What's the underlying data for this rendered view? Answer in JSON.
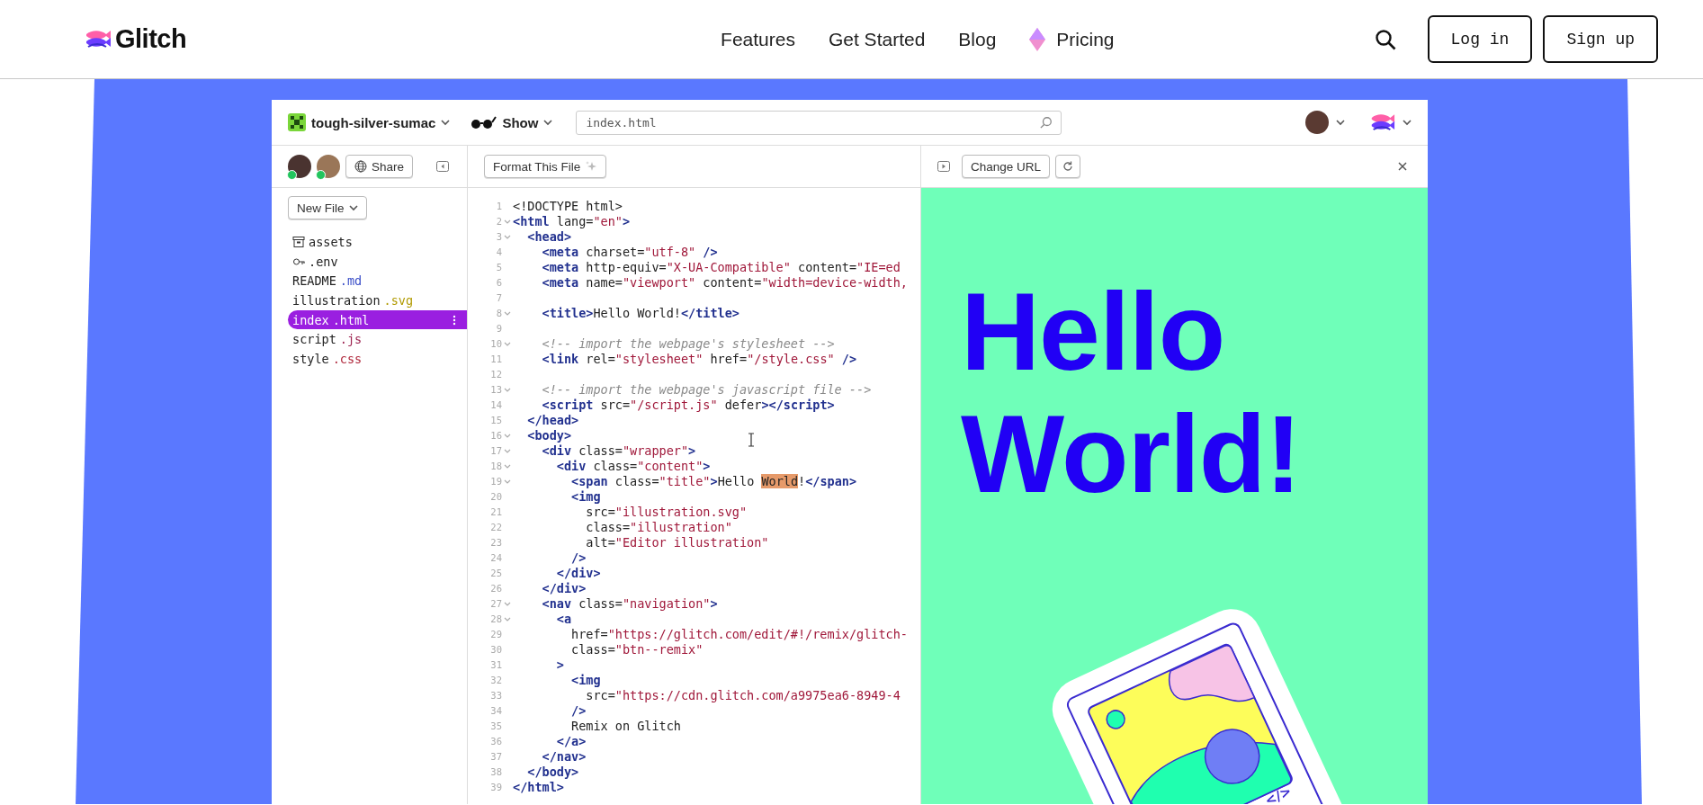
{
  "site_nav": {
    "logo": "Glitch",
    "links": [
      {
        "label": "Features"
      },
      {
        "label": "Get Started"
      },
      {
        "label": "Blog"
      },
      {
        "label": "Pricing",
        "kind": "gem"
      }
    ],
    "buttons": [
      {
        "label": "Log in"
      },
      {
        "label": "Sign up"
      }
    ]
  },
  "editor": {
    "project_name": "tough-silver-sumac",
    "show_label": "Show",
    "search": {
      "value": "index.html"
    },
    "sidebar": {
      "share_label": "Share",
      "new_file_label": "New File",
      "files": [
        {
          "kind": "assets",
          "name": "assets",
          "selected": false
        },
        {
          "kind": "env",
          "name": ".env",
          "selected": false
        },
        {
          "kind": "md",
          "name": "README",
          "extension": ".md",
          "selected": false
        },
        {
          "kind": "svg",
          "name": "illustration",
          "extension": ".svg",
          "selected": false
        },
        {
          "kind": "html",
          "name": "index",
          "extension": ".html",
          "selected": true
        },
        {
          "kind": "js",
          "name": "script",
          "extension": ".js",
          "selected": false
        },
        {
          "kind": "css",
          "name": "style",
          "extension": ".css",
          "selected": false
        }
      ]
    },
    "code_toolbar": {
      "format_label": "Format This File"
    },
    "code": {
      "lines": [
        {
          "number": "1",
          "foldable": false,
          "tokens": [
            {
              "kind": "text",
              "text": "<!DOCTYPE html>"
            }
          ]
        },
        {
          "number": "2",
          "foldable": true,
          "tokens": [
            {
              "kind": "tag",
              "text": "<html"
            },
            {
              "kind": "text",
              "text": " lang="
            },
            {
              "kind": "string",
              "text": "\"en\""
            },
            {
              "kind": "tag",
              "text": ">"
            }
          ]
        },
        {
          "number": "3",
          "foldable": true,
          "tokens": [
            {
              "kind": "tag",
              "text": "  <head>"
            }
          ]
        },
        {
          "number": "4",
          "foldable": false,
          "tokens": [
            {
              "kind": "tag",
              "text": "    <meta"
            },
            {
              "kind": "text",
              "text": " charset="
            },
            {
              "kind": "string",
              "text": "\"utf-8\""
            },
            {
              "kind": "tag",
              "text": " />"
            }
          ]
        },
        {
          "number": "5",
          "foldable": false,
          "tokens": [
            {
              "kind": "tag",
              "text": "    <meta"
            },
            {
              "kind": "text",
              "text": " http-equiv="
            },
            {
              "kind": "string",
              "text": "\"X-UA-Compatible\""
            },
            {
              "kind": "text",
              "text": " content="
            },
            {
              "kind": "string",
              "text": "\"IE=ed"
            }
          ]
        },
        {
          "number": "6",
          "foldable": false,
          "tokens": [
            {
              "kind": "tag",
              "text": "    <meta"
            },
            {
              "kind": "text",
              "text": " name="
            },
            {
              "kind": "string",
              "text": "\"viewport\""
            },
            {
              "kind": "text",
              "text": " content="
            },
            {
              "kind": "string",
              "text": "\"width=device-width,"
            }
          ]
        },
        {
          "number": "7",
          "foldable": false
        },
        {
          "number": "8",
          "foldable": true,
          "tokens": [
            {
              "kind": "tag",
              "text": "    <title>"
            },
            {
              "kind": "text",
              "text": "Hello World!"
            },
            {
              "kind": "tag",
              "text": "</title>"
            }
          ]
        },
        {
          "number": "9",
          "foldable": false
        },
        {
          "number": "10",
          "foldable": true,
          "tokens": [
            {
              "kind": "comment",
              "text": "    <!-- import the webpage's stylesheet -->"
            }
          ]
        },
        {
          "number": "11",
          "foldable": false,
          "tokens": [
            {
              "kind": "tag",
              "text": "    <link"
            },
            {
              "kind": "text",
              "text": " rel="
            },
            {
              "kind": "string",
              "text": "\"stylesheet\""
            },
            {
              "kind": "text",
              "text": " href="
            },
            {
              "kind": "string",
              "text": "\"/style.css\""
            },
            {
              "kind": "tag",
              "text": " />"
            }
          ]
        },
        {
          "number": "12",
          "foldable": false
        },
        {
          "number": "13",
          "foldable": true,
          "tokens": [
            {
              "kind": "comment",
              "text": "    <!-- import the webpage's javascript file -->"
            }
          ]
        },
        {
          "number": "14",
          "foldable": false,
          "tokens": [
            {
              "kind": "tag",
              "text": "    <script"
            },
            {
              "kind": "text",
              "text": " src="
            },
            {
              "kind": "string",
              "text": "\"/script.js\""
            },
            {
              "kind": "text",
              "text": " defer"
            },
            {
              "kind": "tag",
              "text": "></script>"
            }
          ]
        },
        {
          "number": "15",
          "foldable": false,
          "tokens": [
            {
              "kind": "tag",
              "text": "  </head>"
            }
          ]
        },
        {
          "number": "16",
          "foldable": true,
          "tokens": [
            {
              "kind": "tag",
              "text": "  <body>"
            }
          ]
        },
        {
          "number": "17",
          "foldable": true,
          "tokens": [
            {
              "kind": "tag",
              "text": "    <div"
            },
            {
              "kind": "text",
              "text": " class="
            },
            {
              "kind": "string",
              "text": "\"wrapper\""
            },
            {
              "kind": "tag",
              "text": ">"
            }
          ]
        },
        {
          "number": "18",
          "foldable": true,
          "tokens": [
            {
              "kind": "tag",
              "text": "      <div"
            },
            {
              "kind": "text",
              "text": " class="
            },
            {
              "kind": "string",
              "text": "\"content\""
            },
            {
              "kind": "tag",
              "text": ">"
            }
          ]
        },
        {
          "number": "19",
          "foldable": true,
          "tokens": [
            {
              "kind": "tag",
              "text": "        <span"
            },
            {
              "kind": "text",
              "text": " class="
            },
            {
              "kind": "string",
              "text": "\"title\""
            },
            {
              "kind": "tag",
              "text": ">"
            },
            {
              "kind": "text",
              "text": "Hello "
            },
            {
              "kind": "match",
              "text": "World"
            },
            {
              "kind": "text",
              "text": "!"
            },
            {
              "kind": "tag",
              "text": "</span>"
            }
          ]
        },
        {
          "number": "20",
          "foldable": false,
          "tokens": [
            {
              "kind": "tag",
              "text": "        <img"
            }
          ]
        },
        {
          "number": "21",
          "foldable": false,
          "tokens": [
            {
              "kind": "text",
              "text": "          src="
            },
            {
              "kind": "string",
              "text": "\"illustration.svg\""
            }
          ]
        },
        {
          "number": "22",
          "foldable": false,
          "tokens": [
            {
              "kind": "text",
              "text": "          class="
            },
            {
              "kind": "string",
              "text": "\"illustration\""
            }
          ]
        },
        {
          "number": "23",
          "foldable": false,
          "tokens": [
            {
              "kind": "text",
              "text": "          alt="
            },
            {
              "kind": "string",
              "text": "\"Editor illustration\""
            }
          ]
        },
        {
          "number": "24",
          "foldable": false,
          "tokens": [
            {
              "kind": "tag",
              "text": "        />"
            }
          ]
        },
        {
          "number": "25",
          "foldable": false,
          "tokens": [
            {
              "kind": "tag",
              "text": "      </div>"
            }
          ]
        },
        {
          "number": "26",
          "foldable": false,
          "tokens": [
            {
              "kind": "tag",
              "text": "    </div>"
            }
          ]
        },
        {
          "number": "27",
          "foldable": true,
          "tokens": [
            {
              "kind": "tag",
              "text": "    <nav"
            },
            {
              "kind": "text",
              "text": " class="
            },
            {
              "kind": "string",
              "text": "\"navigation\""
            },
            {
              "kind": "tag",
              "text": ">"
            }
          ]
        },
        {
          "number": "28",
          "foldable": true,
          "tokens": [
            {
              "kind": "tag",
              "text": "      <a"
            }
          ]
        },
        {
          "number": "29",
          "foldable": false,
          "tokens": [
            {
              "kind": "text",
              "text": "        href="
            },
            {
              "kind": "string",
              "text": "\"https://glitch.com/edit/#!/remix/glitch-"
            }
          ]
        },
        {
          "number": "30",
          "foldable": false,
          "tokens": [
            {
              "kind": "text",
              "text": "        class="
            },
            {
              "kind": "string",
              "text": "\"btn--remix\""
            }
          ]
        },
        {
          "number": "31",
          "foldable": false,
          "tokens": [
            {
              "kind": "tag",
              "text": "      >"
            }
          ]
        },
        {
          "number": "32",
          "foldable": false,
          "tokens": [
            {
              "kind": "tag",
              "text": "        <img"
            }
          ]
        },
        {
          "number": "33",
          "foldable": false,
          "tokens": [
            {
              "kind": "text",
              "text": "          src="
            },
            {
              "kind": "string",
              "text": "\"https://cdn.glitch.com/a9975ea6-8949-4"
            }
          ]
        },
        {
          "number": "34",
          "foldable": false,
          "tokens": [
            {
              "kind": "tag",
              "text": "        />"
            }
          ]
        },
        {
          "number": "35",
          "foldable": false,
          "tokens": [
            {
              "kind": "text",
              "text": "        Remix on Glitch"
            }
          ]
        },
        {
          "number": "36",
          "foldable": false,
          "tokens": [
            {
              "kind": "tag",
              "text": "      </a>"
            }
          ]
        },
        {
          "number": "37",
          "foldable": false,
          "tokens": [
            {
              "kind": "tag",
              "text": "    </nav>"
            }
          ]
        },
        {
          "number": "38",
          "foldable": false,
          "tokens": [
            {
              "kind": "tag",
              "text": "  </body>"
            }
          ]
        },
        {
          "number": "39",
          "foldable": false,
          "tokens": [
            {
              "kind": "tag",
              "text": "</html>"
            }
          ]
        }
      ]
    },
    "preview": {
      "change_url_label": "Change URL",
      "heading": "Hello World!",
      "illustration_label": "</>"
    }
  }
}
